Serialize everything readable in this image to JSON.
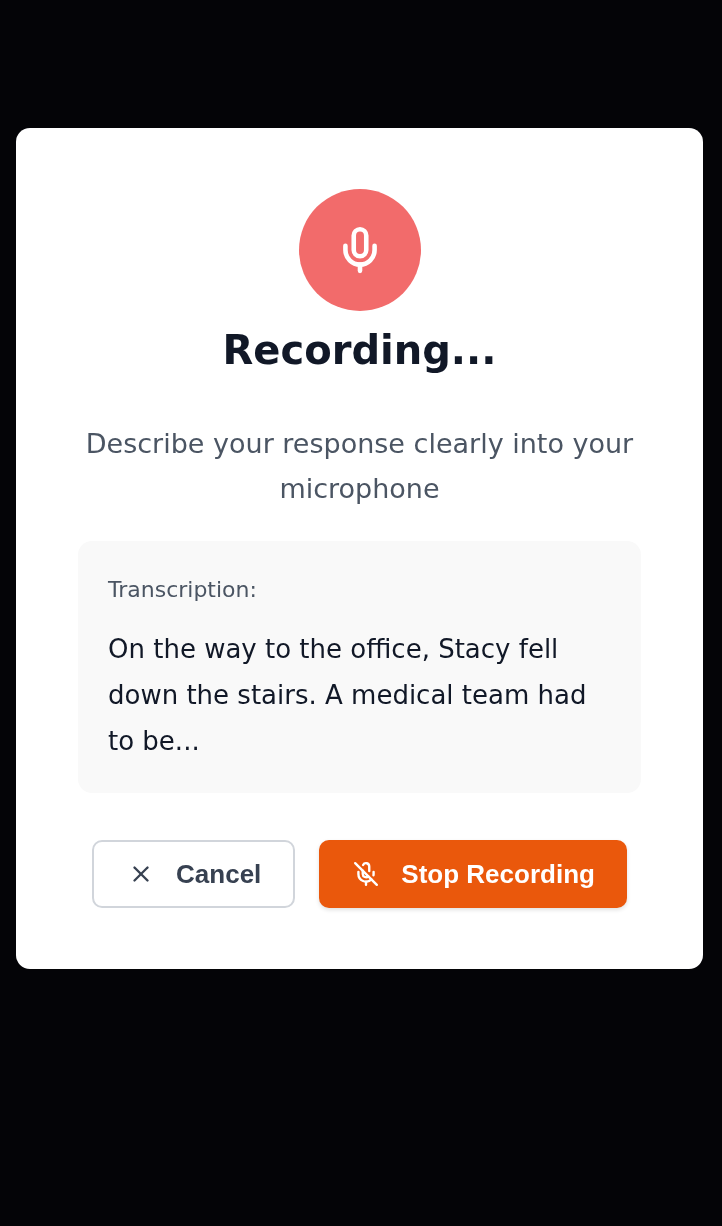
{
  "dialog": {
    "title": "Recording...",
    "subtitle": "Describe your response clearly into your microphone",
    "transcription": {
      "label": "Transcription:",
      "text": "On the way to the office, Stacy fell down the stairs. A medical team had to be..."
    },
    "buttons": [
      {
        "kind": "secondary",
        "label": "Cancel"
      },
      {
        "kind": "primary",
        "label": "Stop Recording"
      }
    ]
  }
}
